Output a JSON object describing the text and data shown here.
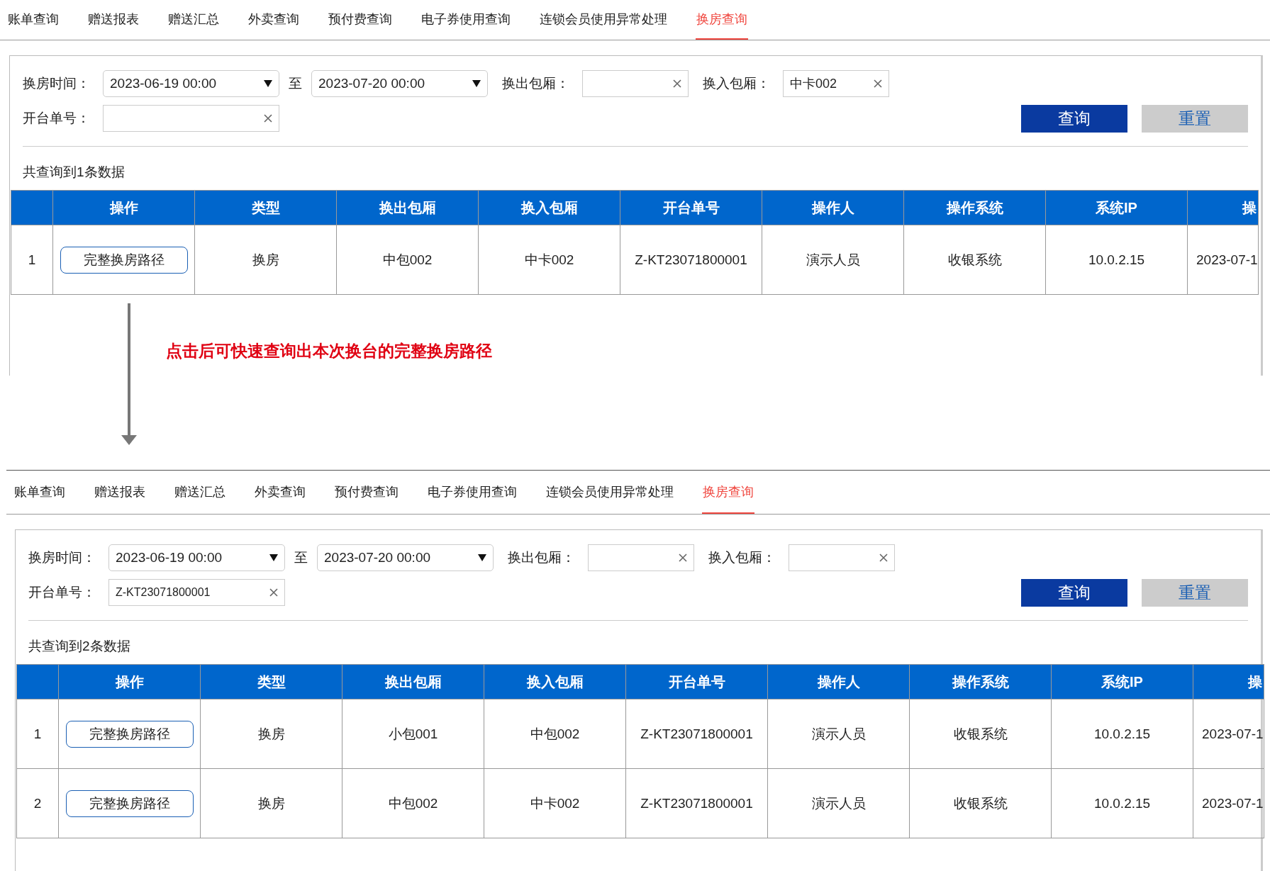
{
  "screens": [
    {
      "tabs": [
        {
          "label": "账单查询",
          "selected": false
        },
        {
          "label": "赠送报表",
          "selected": false
        },
        {
          "label": "赠送汇总",
          "selected": false
        },
        {
          "label": "外卖查询",
          "selected": false
        },
        {
          "label": "预付费查询",
          "selected": false
        },
        {
          "label": "电子券使用查询",
          "selected": false
        },
        {
          "label": "连锁会员使用异常处理",
          "selected": false
        },
        {
          "label": "换房查询",
          "selected": true
        }
      ],
      "filters": {
        "time_label": "换房时间：",
        "time_from": "2023-06-19 00:00",
        "time_sep": "至",
        "time_to": "2023-07-20 00:00",
        "out_room": {
          "label": "换出包厢："
        },
        "in_room": {
          "label": "换入包厢：",
          "value": "中卡002"
        },
        "order": {
          "label": "开台单号："
        }
      },
      "buttons": {
        "search": "查询",
        "reset": "重置"
      },
      "result_count": "共查询到1条数据",
      "table": {
        "columns": [
          "操作",
          "类型",
          "换出包厢",
          "换入包厢",
          "开台单号",
          "操作人",
          "操作系统",
          "系统IP",
          "操"
        ],
        "rows": [
          {
            "index": "1",
            "cells": [
              "完整换房路径",
              "换房",
              "中包002",
              "中卡002",
              "Z-KT23071800001",
              "演示人员",
              "收银系统",
              "10.0.2.15",
              "2023-07-1"
            ]
          }
        ]
      }
    },
    {
      "tabs": [
        {
          "label": "账单查询",
          "selected": false
        },
        {
          "label": "赠送报表",
          "selected": false
        },
        {
          "label": "赠送汇总",
          "selected": false
        },
        {
          "label": "外卖查询",
          "selected": false
        },
        {
          "label": "预付费查询",
          "selected": false
        },
        {
          "label": "电子券使用查询",
          "selected": false
        },
        {
          "label": "连锁会员使用异常处理",
          "selected": false
        },
        {
          "label": "换房查询",
          "selected": true
        }
      ],
      "filters": {
        "time_label": "换房时间：",
        "time_from": "2023-06-19 00:00",
        "time_sep": "至",
        "time_to": "2023-07-20 00:00",
        "out_room": {
          "label": "换出包厢："
        },
        "in_room": {
          "label": "换入包厢："
        },
        "order": {
          "label": "开台单号：",
          "value": "Z-KT23071800001"
        }
      },
      "buttons": {
        "search": "查询",
        "reset": "重置"
      },
      "result_count": "共查询到2条数据",
      "table": {
        "columns": [
          "操作",
          "类型",
          "换出包厢",
          "换入包厢",
          "开台单号",
          "操作人",
          "操作系统",
          "系统IP",
          "操"
        ],
        "rows": [
          {
            "index": "1",
            "cells": [
              "完整换房路径",
              "换房",
              "小包001",
              "中包002",
              "Z-KT23071800001",
              "演示人员",
              "收银系统",
              "10.0.2.15",
              "2023-07-1"
            ]
          },
          {
            "index": "2",
            "cells": [
              "完整换房路径",
              "换房",
              "中包002",
              "中卡002",
              "Z-KT23071800001",
              "演示人员",
              "收银系统",
              "10.0.2.15",
              "2023-07-1"
            ]
          }
        ]
      }
    }
  ],
  "annotation": {
    "text": "点击后可快速查询出本次换台的完整换房路径"
  }
}
